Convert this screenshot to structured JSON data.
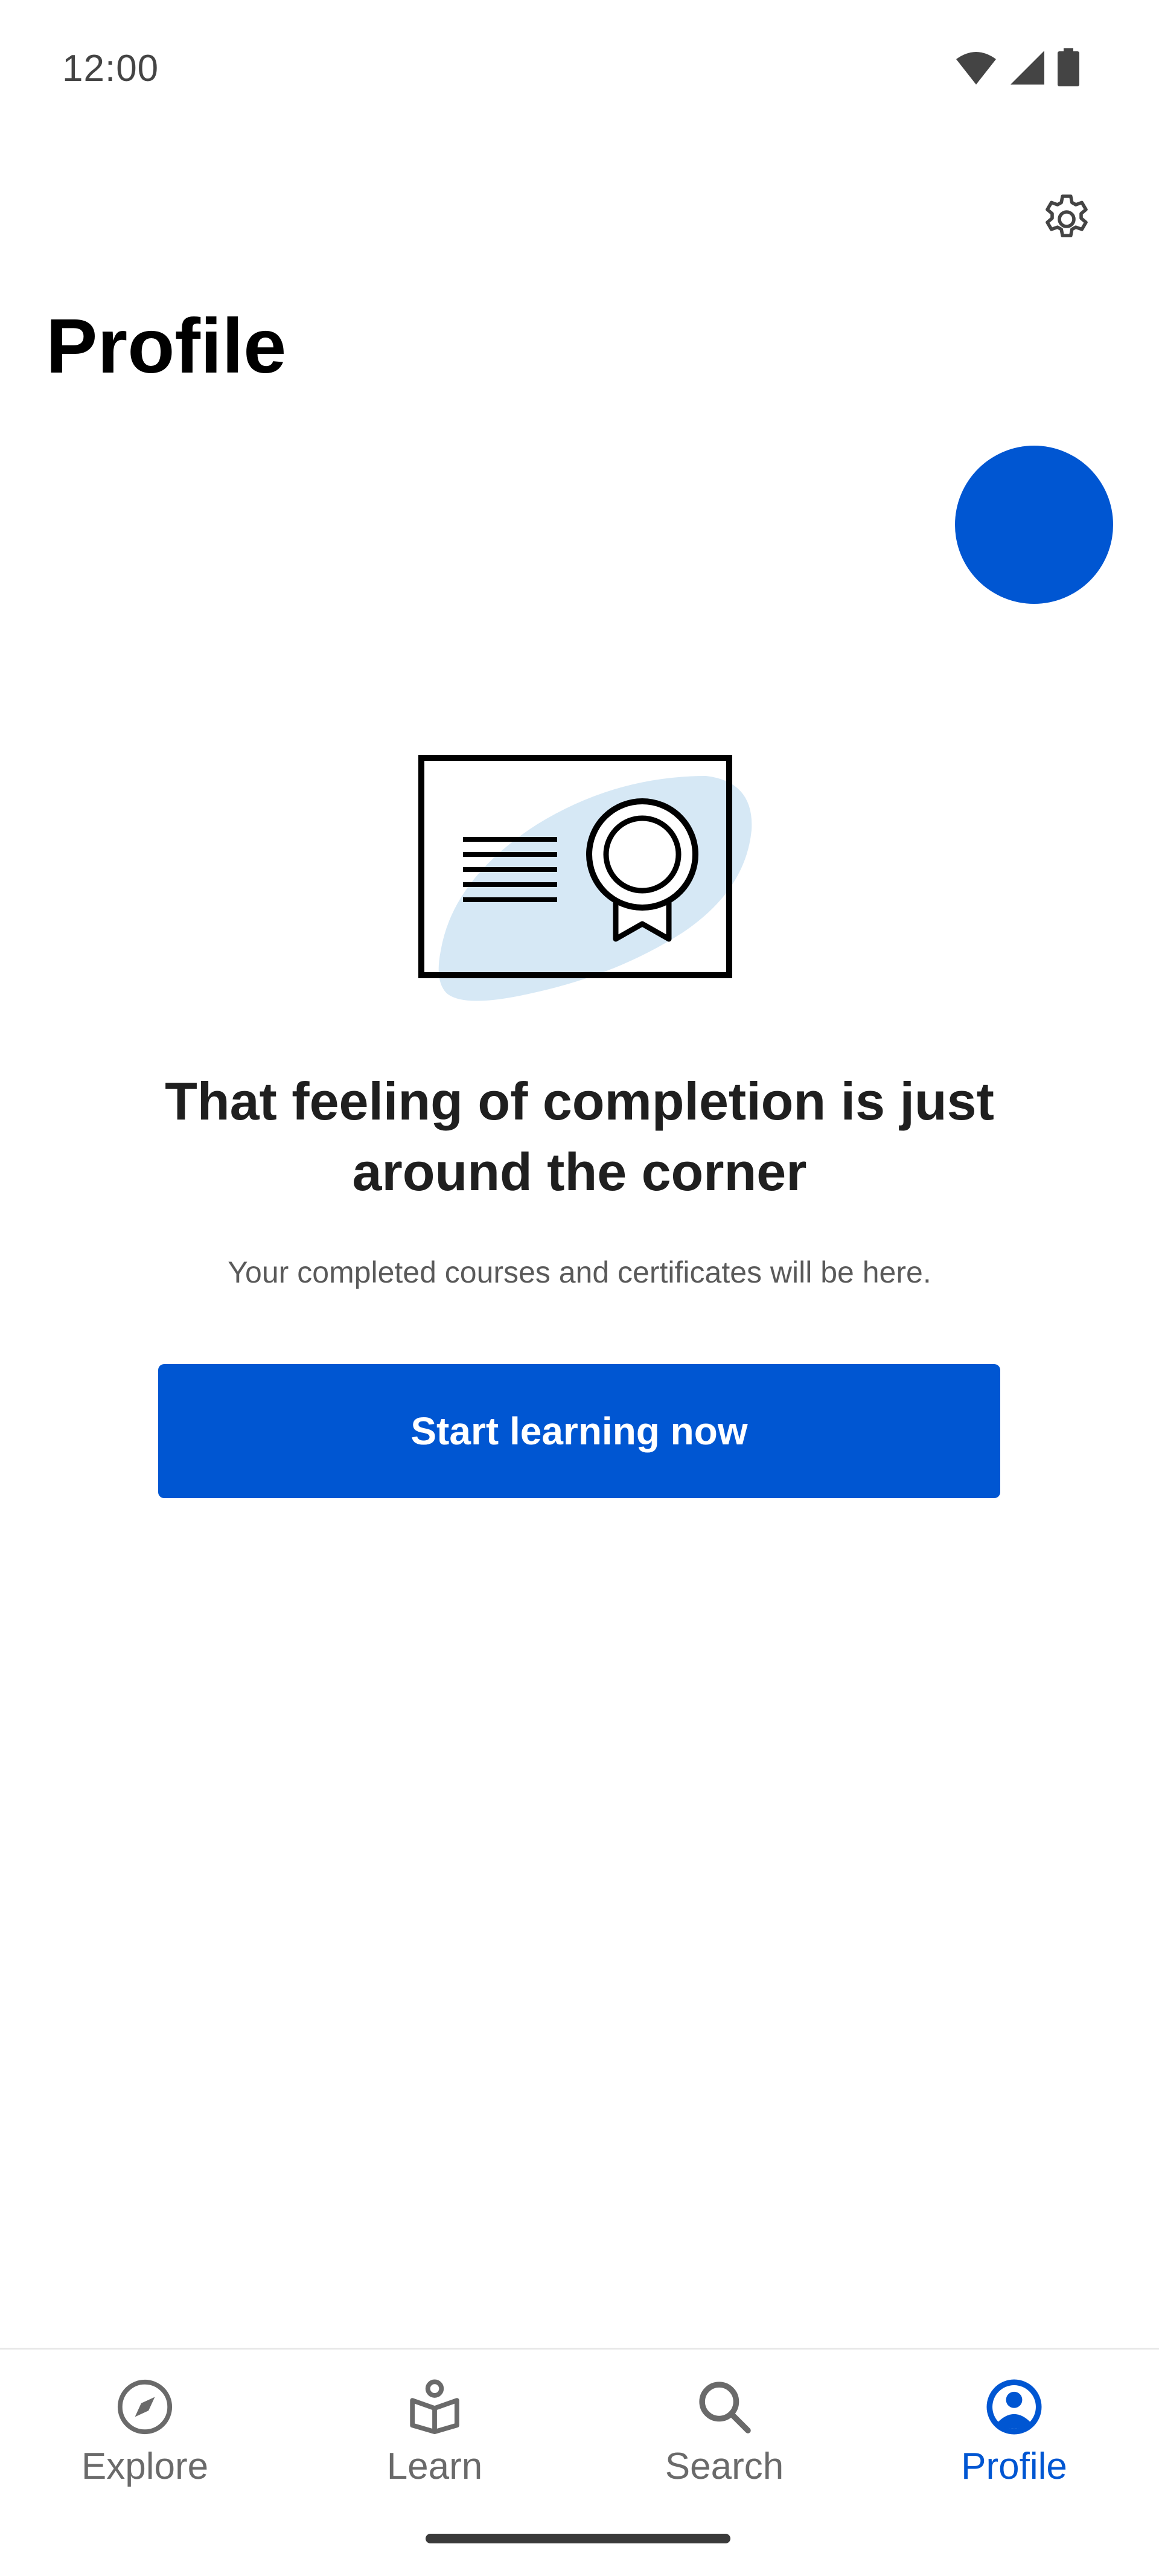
{
  "status_bar": {
    "time": "12:00"
  },
  "header": {
    "title": "Profile",
    "settings_icon": "gear-icon"
  },
  "profile": {
    "avatar_color": "#0056d2"
  },
  "empty_state": {
    "illustration": "certificate-icon",
    "heading": "That feeling of completion is just around the corner",
    "subtext": "Your completed courses and certificates will be here.",
    "cta_label": "Start learning now"
  },
  "bottom_nav": {
    "items": [
      {
        "label": "Explore",
        "icon": "compass-icon",
        "active": false
      },
      {
        "label": "Learn",
        "icon": "book-reader-icon",
        "active": false
      },
      {
        "label": "Search",
        "icon": "search-icon",
        "active": false
      },
      {
        "label": "Profile",
        "icon": "user-circle-icon",
        "active": true
      }
    ]
  },
  "colors": {
    "accent": "#0056d2",
    "illustration_blob": "#d6e8f5",
    "inactive": "#6a6a6a"
  }
}
